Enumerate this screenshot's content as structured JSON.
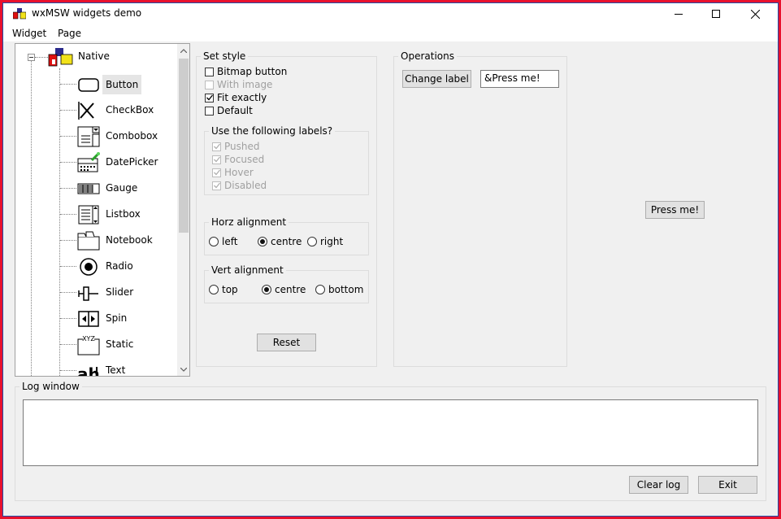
{
  "window": {
    "title": "wxMSW widgets demo"
  },
  "menu": [
    "Widget",
    "Page"
  ],
  "tree": {
    "root": "Native",
    "items": [
      {
        "label": "Button",
        "icon": "button-icon",
        "selected": true
      },
      {
        "label": "CheckBox",
        "icon": "checkbox-icon"
      },
      {
        "label": "Combobox",
        "icon": "combobox-icon"
      },
      {
        "label": "DatePicker",
        "icon": "datepicker-icon"
      },
      {
        "label": "Gauge",
        "icon": "gauge-icon"
      },
      {
        "label": "Listbox",
        "icon": "listbox-icon"
      },
      {
        "label": "Notebook",
        "icon": "notebook-icon"
      },
      {
        "label": "Radio",
        "icon": "radio-icon"
      },
      {
        "label": "Slider",
        "icon": "slider-icon"
      },
      {
        "label": "Spin",
        "icon": "spin-icon"
      },
      {
        "label": "Static",
        "icon": "static-icon"
      },
      {
        "label": "Text",
        "icon": "text-icon"
      }
    ]
  },
  "set_style": {
    "title": "Set style",
    "bitmap_button": "Bitmap button",
    "with_image": "With image",
    "fit_exactly": "Fit exactly",
    "default": "Default",
    "labels_group": {
      "title": "Use the following labels?",
      "pushed": "Pushed",
      "focused": "Focused",
      "hover": "Hover",
      "disabled": "Disabled"
    },
    "horz": {
      "title": "Horz alignment",
      "left": "left",
      "centre": "centre",
      "right": "right"
    },
    "vert": {
      "title": "Vert alignment",
      "top": "top",
      "centre": "centre",
      "bottom": "bottom"
    },
    "reset": "Reset"
  },
  "operations": {
    "title": "Operations",
    "change_label": "Change label",
    "label_value": "&Press me!"
  },
  "demo_button": "Press me!",
  "log": {
    "title": "Log window",
    "clear": "Clear log",
    "exit": "Exit"
  }
}
